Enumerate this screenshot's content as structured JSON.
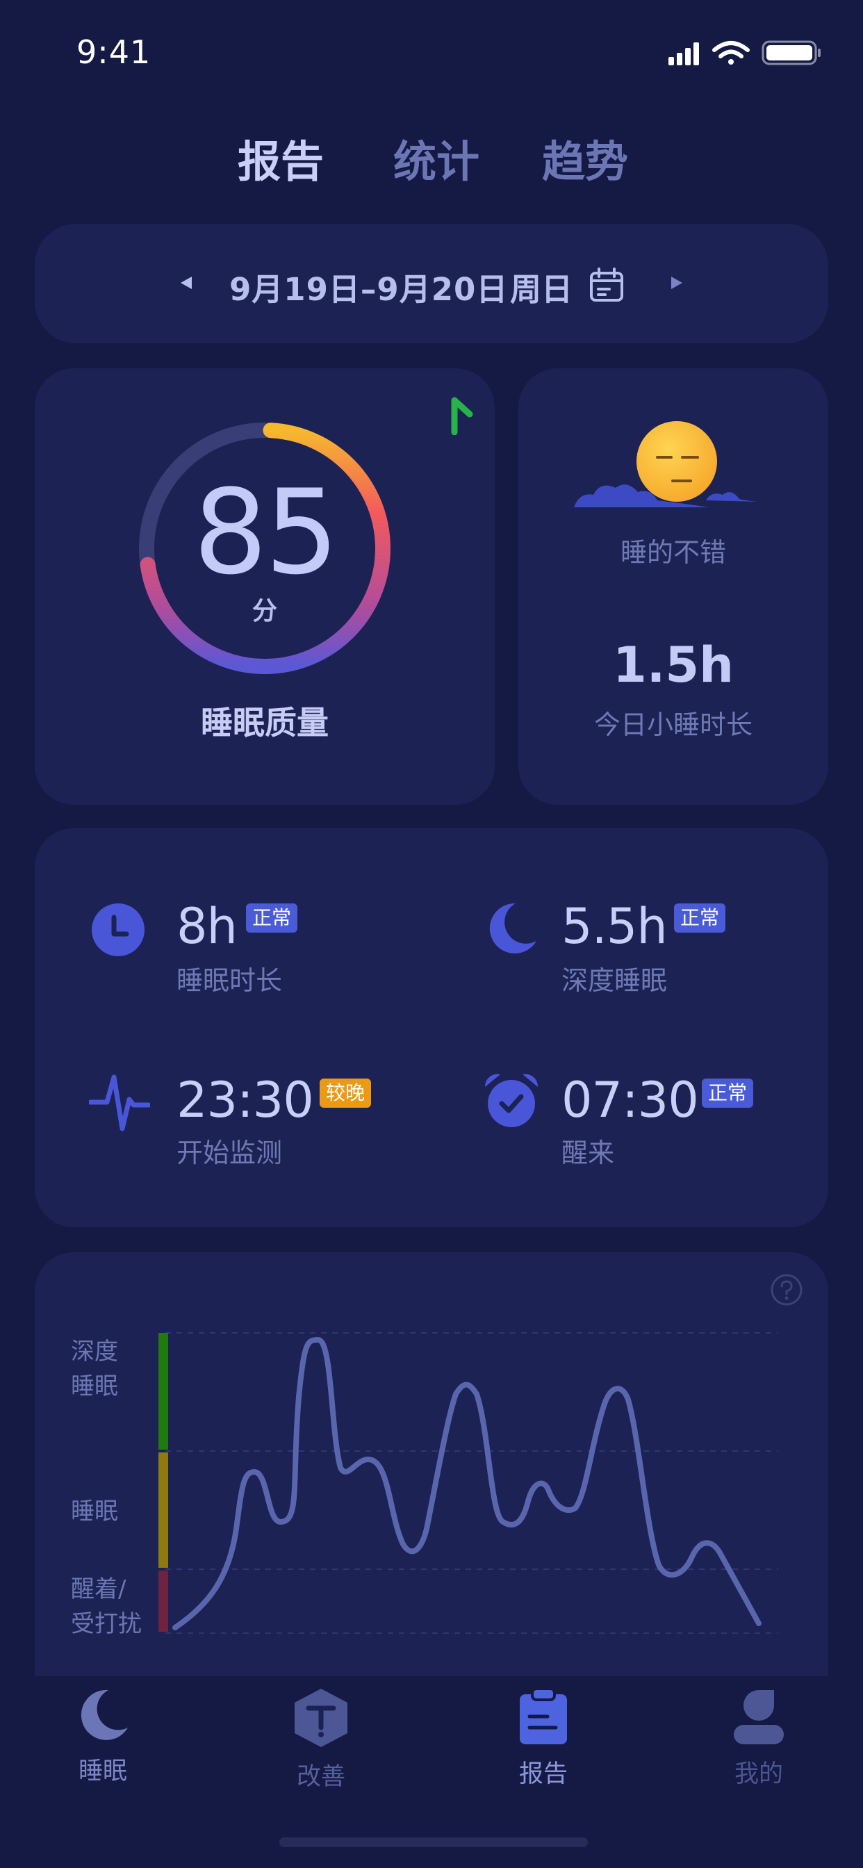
{
  "status_bar": {
    "time": "9:41"
  },
  "tabs": [
    {
      "label": "报告",
      "active": true
    },
    {
      "label": "统计",
      "active": false
    },
    {
      "label": "趋势",
      "active": false
    }
  ],
  "date_bar": {
    "range": "9月19日–9月20日",
    "weekday": "周日"
  },
  "score": {
    "value": "85",
    "unit": "分",
    "label": "睡眠质量",
    "ring_fill_fraction": 0.72,
    "trend": "up"
  },
  "nap": {
    "mood": "睡的不错",
    "value": "1.5h",
    "label": "今日小睡时长"
  },
  "metrics": {
    "duration": {
      "value": "8h",
      "badge": "正常",
      "label": "睡眠时长",
      "icon": "clock-icon"
    },
    "deep": {
      "value": "5.5h",
      "badge": "正常",
      "label": "深度睡眠",
      "icon": "moon-icon"
    },
    "start": {
      "value": "23:30",
      "badge": "较晚",
      "label": "开始监测",
      "icon": "heartbeat-icon"
    },
    "wake": {
      "value": "07:30",
      "badge": "正常",
      "label": "醒来",
      "icon": "alarm-clock-icon"
    }
  },
  "chart": {
    "levels": {
      "deep": "深度睡眠",
      "sleep": "睡眠",
      "awake": "醒着/受打扰"
    },
    "colors": {
      "deep": "#1f7a10",
      "sleep": "#8f7a10",
      "awake": "#6e2440",
      "line": "#5965ad"
    }
  },
  "bottom_nav": [
    {
      "label": "睡眠",
      "active": false,
      "icon": "moon-icon"
    },
    {
      "label": "改善",
      "active": false,
      "icon": "improve-icon"
    },
    {
      "label": "报告",
      "active": true,
      "icon": "report-clipboard-icon"
    },
    {
      "label": "我的",
      "active": false,
      "icon": "user-icon"
    }
  ]
}
